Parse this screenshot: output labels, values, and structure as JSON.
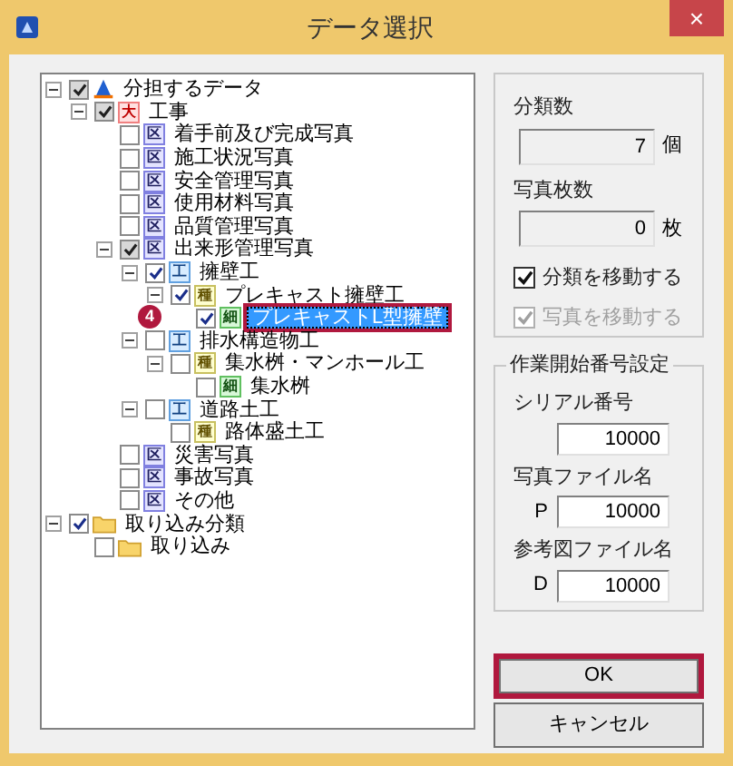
{
  "window": {
    "title": "データ選択",
    "close": "×"
  },
  "tree": [
    {
      "label": "分担するデータ",
      "kind": "root",
      "checked": true,
      "grayed": true,
      "expanded": true,
      "selected": false,
      "children": [
        {
          "label": "工事",
          "kind": "大",
          "checked": true,
          "grayed": true,
          "expanded": true,
          "selected": false,
          "children": [
            {
              "label": "着手前及び完成写真",
              "kind": "区",
              "checked": false,
              "grayed": false,
              "selected": false
            },
            {
              "label": "施工状況写真",
              "kind": "区",
              "checked": false,
              "grayed": false,
              "selected": false
            },
            {
              "label": "安全管理写真",
              "kind": "区",
              "checked": false,
              "grayed": false,
              "selected": false
            },
            {
              "label": "使用材料写真",
              "kind": "区",
              "checked": false,
              "grayed": false,
              "selected": false
            },
            {
              "label": "品質管理写真",
              "kind": "区",
              "checked": false,
              "grayed": false,
              "selected": false
            },
            {
              "label": "出来形管理写真",
              "kind": "区",
              "checked": true,
              "grayed": true,
              "expanded": true,
              "selected": false,
              "children": [
                {
                  "label": "擁壁工",
                  "kind": "工",
                  "checked": true,
                  "grayed": false,
                  "expanded": true,
                  "selected": false,
                  "children": [
                    {
                      "label": "プレキャスト擁壁工",
                      "kind": "種",
                      "checked": true,
                      "grayed": false,
                      "expanded": true,
                      "selected": false,
                      "children": [
                        {
                          "label": "プレキャストL型擁壁",
                          "kind": "細",
                          "checked": true,
                          "grayed": false,
                          "selected": true
                        }
                      ]
                    }
                  ]
                },
                {
                  "label": "排水構造物工",
                  "kind": "工",
                  "checked": false,
                  "grayed": false,
                  "expanded": true,
                  "selected": false,
                  "children": [
                    {
                      "label": "集水桝・マンホール工",
                      "kind": "種",
                      "checked": false,
                      "grayed": false,
                      "expanded": true,
                      "selected": false,
                      "children": [
                        {
                          "label": "集水桝",
                          "kind": "細",
                          "checked": false,
                          "grayed": false,
                          "selected": false
                        }
                      ]
                    }
                  ]
                },
                {
                  "label": "道路土工",
                  "kind": "工",
                  "checked": false,
                  "grayed": false,
                  "expanded": true,
                  "selected": false,
                  "children": [
                    {
                      "label": "路体盛土工",
                      "kind": "種",
                      "checked": false,
                      "grayed": false,
                      "selected": false
                    }
                  ]
                }
              ]
            },
            {
              "label": "災害写真",
              "kind": "区",
              "checked": false,
              "grayed": false,
              "selected": false
            },
            {
              "label": "事故写真",
              "kind": "区",
              "checked": false,
              "grayed": false,
              "selected": false
            },
            {
              "label": "その他",
              "kind": "区",
              "checked": false,
              "grayed": false,
              "selected": false
            }
          ]
        }
      ]
    },
    {
      "label": "取り込み分類",
      "kind": "folder",
      "checked": true,
      "grayed": false,
      "expanded": true,
      "selected": false,
      "children": [
        {
          "label": "取り込み",
          "kind": "folder",
          "checked": false,
          "grayed": false,
          "selected": false
        }
      ]
    }
  ],
  "callout": {
    "number": "4"
  },
  "counts": [
    {
      "label": "分類数",
      "value": "7",
      "unit": "個"
    },
    {
      "label": "写真枚数",
      "value": "0",
      "unit": "枚"
    }
  ],
  "options": [
    {
      "label": "分類を移動する",
      "checked": true,
      "disabled": false
    },
    {
      "label": "写真を移動する",
      "checked": true,
      "disabled": true
    }
  ],
  "numbering": {
    "title": "作業開始番号設定",
    "fields": [
      {
        "label": "シリアル番号",
        "value": "10000"
      },
      {
        "label": "写真ファイル名",
        "prefix": "P",
        "value": "10000"
      },
      {
        "label": "参考図ファイル名",
        "prefix": "D",
        "value": "10000"
      }
    ]
  },
  "buttons": [
    {
      "label": "OK",
      "highlighted": true
    },
    {
      "label": "キャンセル",
      "highlighted": false
    }
  ]
}
